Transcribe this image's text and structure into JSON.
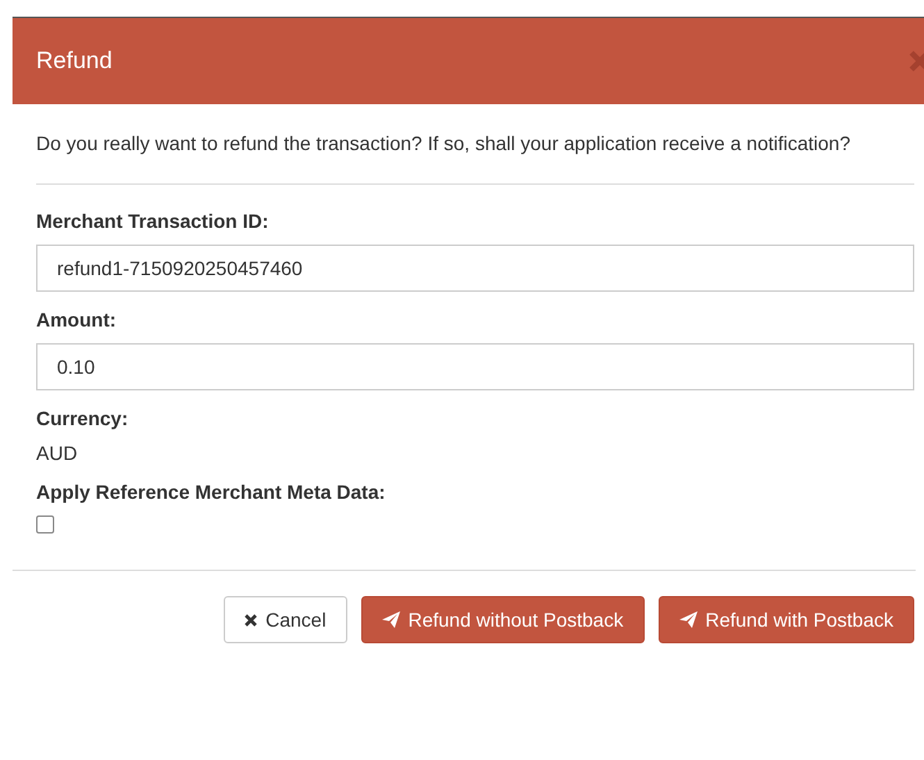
{
  "dialog": {
    "title": "Refund",
    "message": "Do you really want to refund the transaction? If so, shall your application receive a notification?"
  },
  "fields": [
    {
      "kind": "input",
      "label": "Merchant Transaction ID:",
      "value": "refund1-7150920250457460"
    },
    {
      "kind": "input",
      "label": "Amount:",
      "value": "0.10"
    },
    {
      "kind": "text",
      "label": "Currency:",
      "value": "AUD"
    },
    {
      "kind": "checkbox",
      "label": "Apply Reference Merchant Meta Data:",
      "checked": false
    }
  ],
  "buttons": [
    {
      "kind": "cancel",
      "label": "Cancel"
    },
    {
      "kind": "primary",
      "label": "Refund without Postback"
    },
    {
      "kind": "primary",
      "label": "Refund with Postback"
    }
  ]
}
